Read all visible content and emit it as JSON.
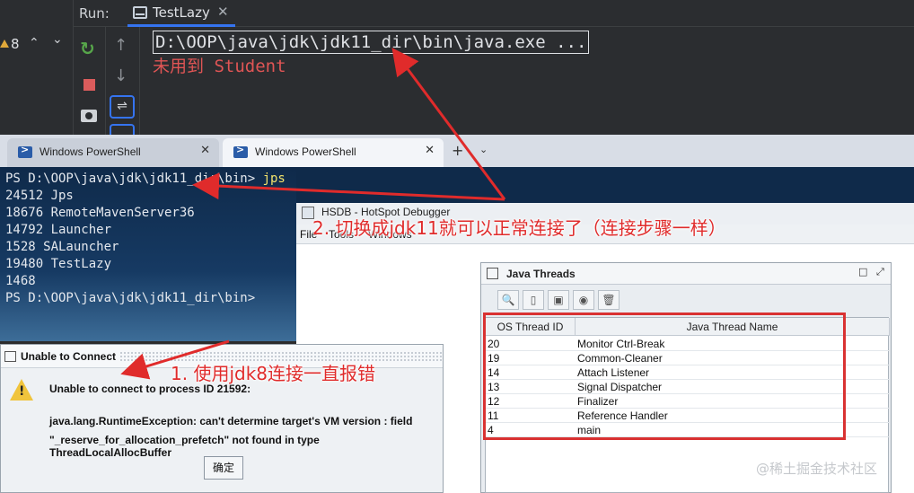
{
  "ide": {
    "run_label": "Run:",
    "tab_label": "TestLazy",
    "tab_close": "✕",
    "warning_count": "8",
    "console_cmd": "D:\\OOP\\java\\jdk\\jdk11_dir\\bin\\java.exe ...",
    "console_out": "未用到 Student"
  },
  "powershell": {
    "tabs": [
      {
        "label": "Windows PowerShell"
      },
      {
        "label": "Windows PowerShell"
      }
    ],
    "tab_close": "✕",
    "new_tab": "+",
    "lines": [
      "24512 Jps",
      "18676 RemoteMavenServer36",
      "14792 Launcher",
      "1528 SALauncher",
      "19480 TestLazy",
      "1468",
      "PS D:\\OOP\\java\\jdk\\jdk11_dir\\bin>"
    ],
    "prompt": "PS D:\\OOP\\java\\jdk\\jdk11_dir\\bin> ",
    "command": "jps"
  },
  "hsdb": {
    "title": "HSDB - HotSpot Debugger",
    "menu": [
      "File",
      "Tools",
      "Windows"
    ],
    "java_threads": {
      "title": "Java Threads",
      "columns": [
        "OS Thread ID",
        "Java Thread Name"
      ],
      "rows": [
        {
          "id": "20",
          "name": "Monitor Ctrl-Break"
        },
        {
          "id": "19",
          "name": "Common-Cleaner"
        },
        {
          "id": "14",
          "name": "Attach Listener"
        },
        {
          "id": "13",
          "name": "Signal Dispatcher"
        },
        {
          "id": "12",
          "name": "Finalizer"
        },
        {
          "id": "11",
          "name": "Reference Handler"
        },
        {
          "id": "4",
          "name": "main"
        }
      ]
    }
  },
  "dialog": {
    "title": "Unable to Connect",
    "line1": "Unable to connect to process ID 21592:",
    "line2": "java.lang.RuntimeException: can't determine target's VM version : field",
    "line3": "\"_reserve_for_allocation_prefetch\" not found in type ThreadLocalAllocBuffer",
    "ok_label": "确定"
  },
  "annotations": {
    "note1": "1. 使用jdk8连接一直报错",
    "note2": "2. 切换成jdk11就可以正常连接了（连接步骤一样）"
  },
  "watermark": "@稀土掘金技术社区",
  "colors": {
    "annotation": "#e02b2b",
    "accent": "#3574f0"
  }
}
